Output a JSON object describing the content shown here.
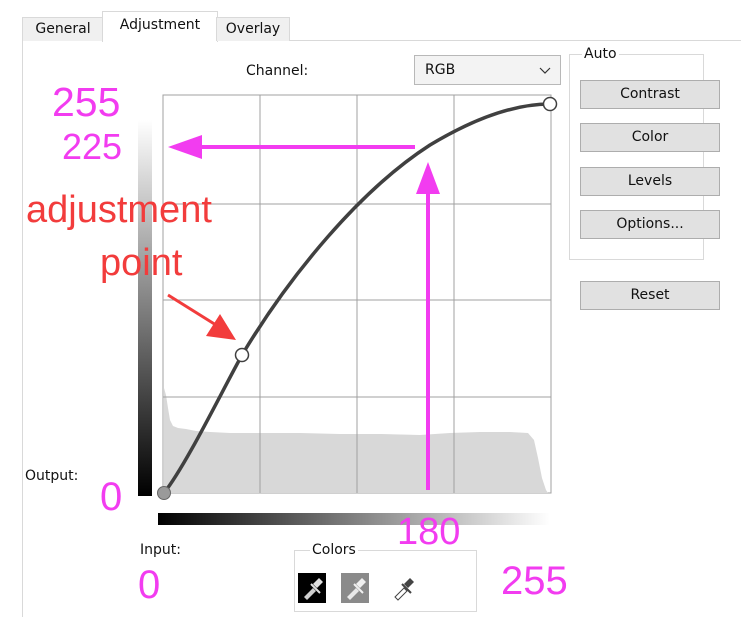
{
  "tabs": [
    {
      "label": "General"
    },
    {
      "label": "Adjustment"
    },
    {
      "label": "Overlay"
    }
  ],
  "channel": {
    "label": "Channel:",
    "value": "RGB"
  },
  "auto": {
    "title": "Auto",
    "buttons": {
      "contrast": "Contrast",
      "color": "Color",
      "levels": "Levels",
      "options": "Options..."
    }
  },
  "reset_label": "Reset",
  "output_label": "Output:",
  "input_label": "Input:",
  "colors": {
    "title": "Colors"
  },
  "annotations": {
    "out_max": "255",
    "out_225": "225",
    "adjustment": "adjustment",
    "point": "point",
    "out_zero": "0",
    "in_180": "180",
    "in_zero": "0",
    "in_max": "255"
  },
  "colors_palette": {
    "annotation_magenta": "#f23cf0",
    "annotation_red": "#f23c3c",
    "curve": "#404040"
  }
}
